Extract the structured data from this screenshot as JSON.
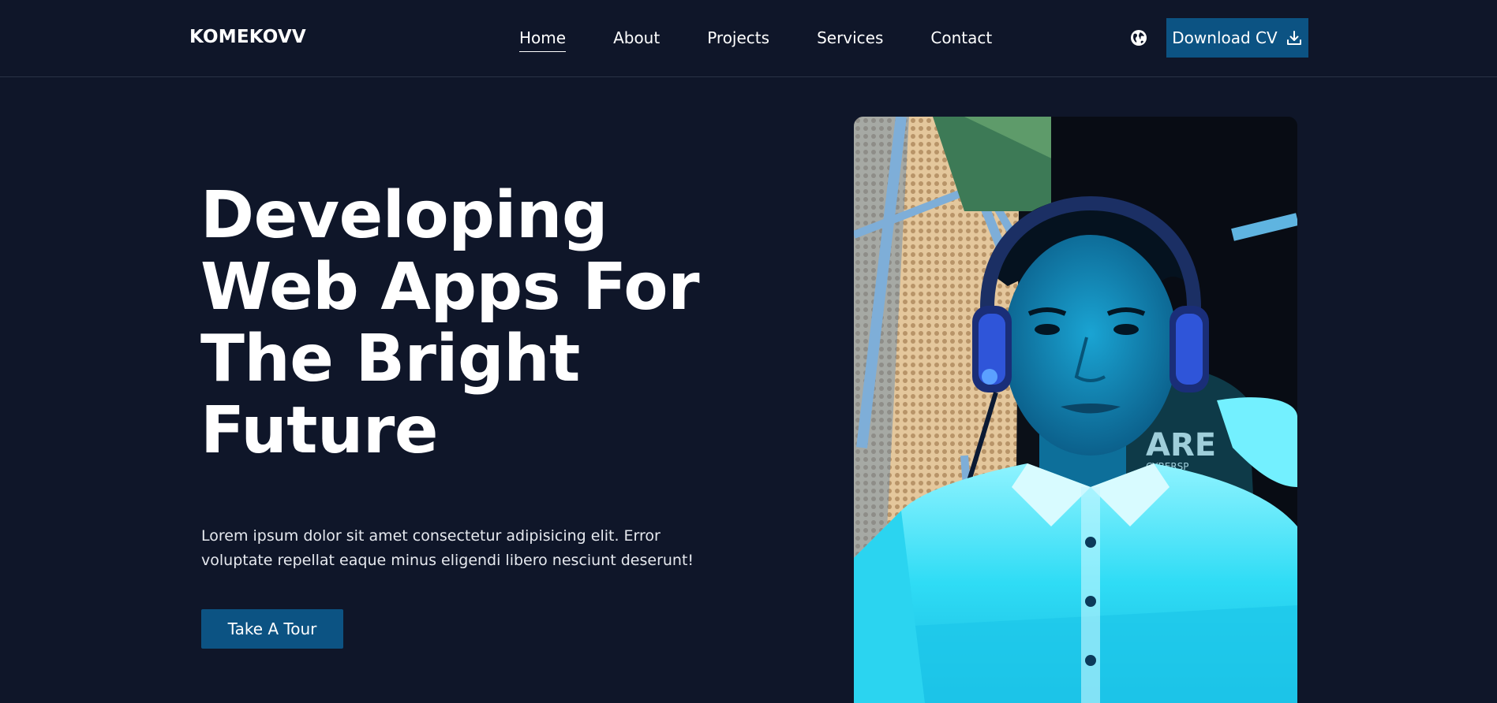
{
  "header": {
    "logo": "KOMEKOVV",
    "nav": [
      {
        "label": "Home",
        "active": true
      },
      {
        "label": "About",
        "active": false
      },
      {
        "label": "Projects",
        "active": false
      },
      {
        "label": "Services",
        "active": false
      },
      {
        "label": "Contact",
        "active": false
      }
    ],
    "language_icon": "globe-icon",
    "download_cv_label": "Download CV",
    "download_icon": "download-icon"
  },
  "hero": {
    "title": "Developing Web Apps For The Bright Future",
    "description": "Lorem ipsum dolor sit amet consectetur adipisicing elit. Error voluptate repellat eaque minus eligendi libero nesciunt deserunt!",
    "cta_label": "Take A Tour"
  },
  "colors": {
    "background": "#0f1629",
    "accent": "#0c5383",
    "text": "#ffffff"
  }
}
